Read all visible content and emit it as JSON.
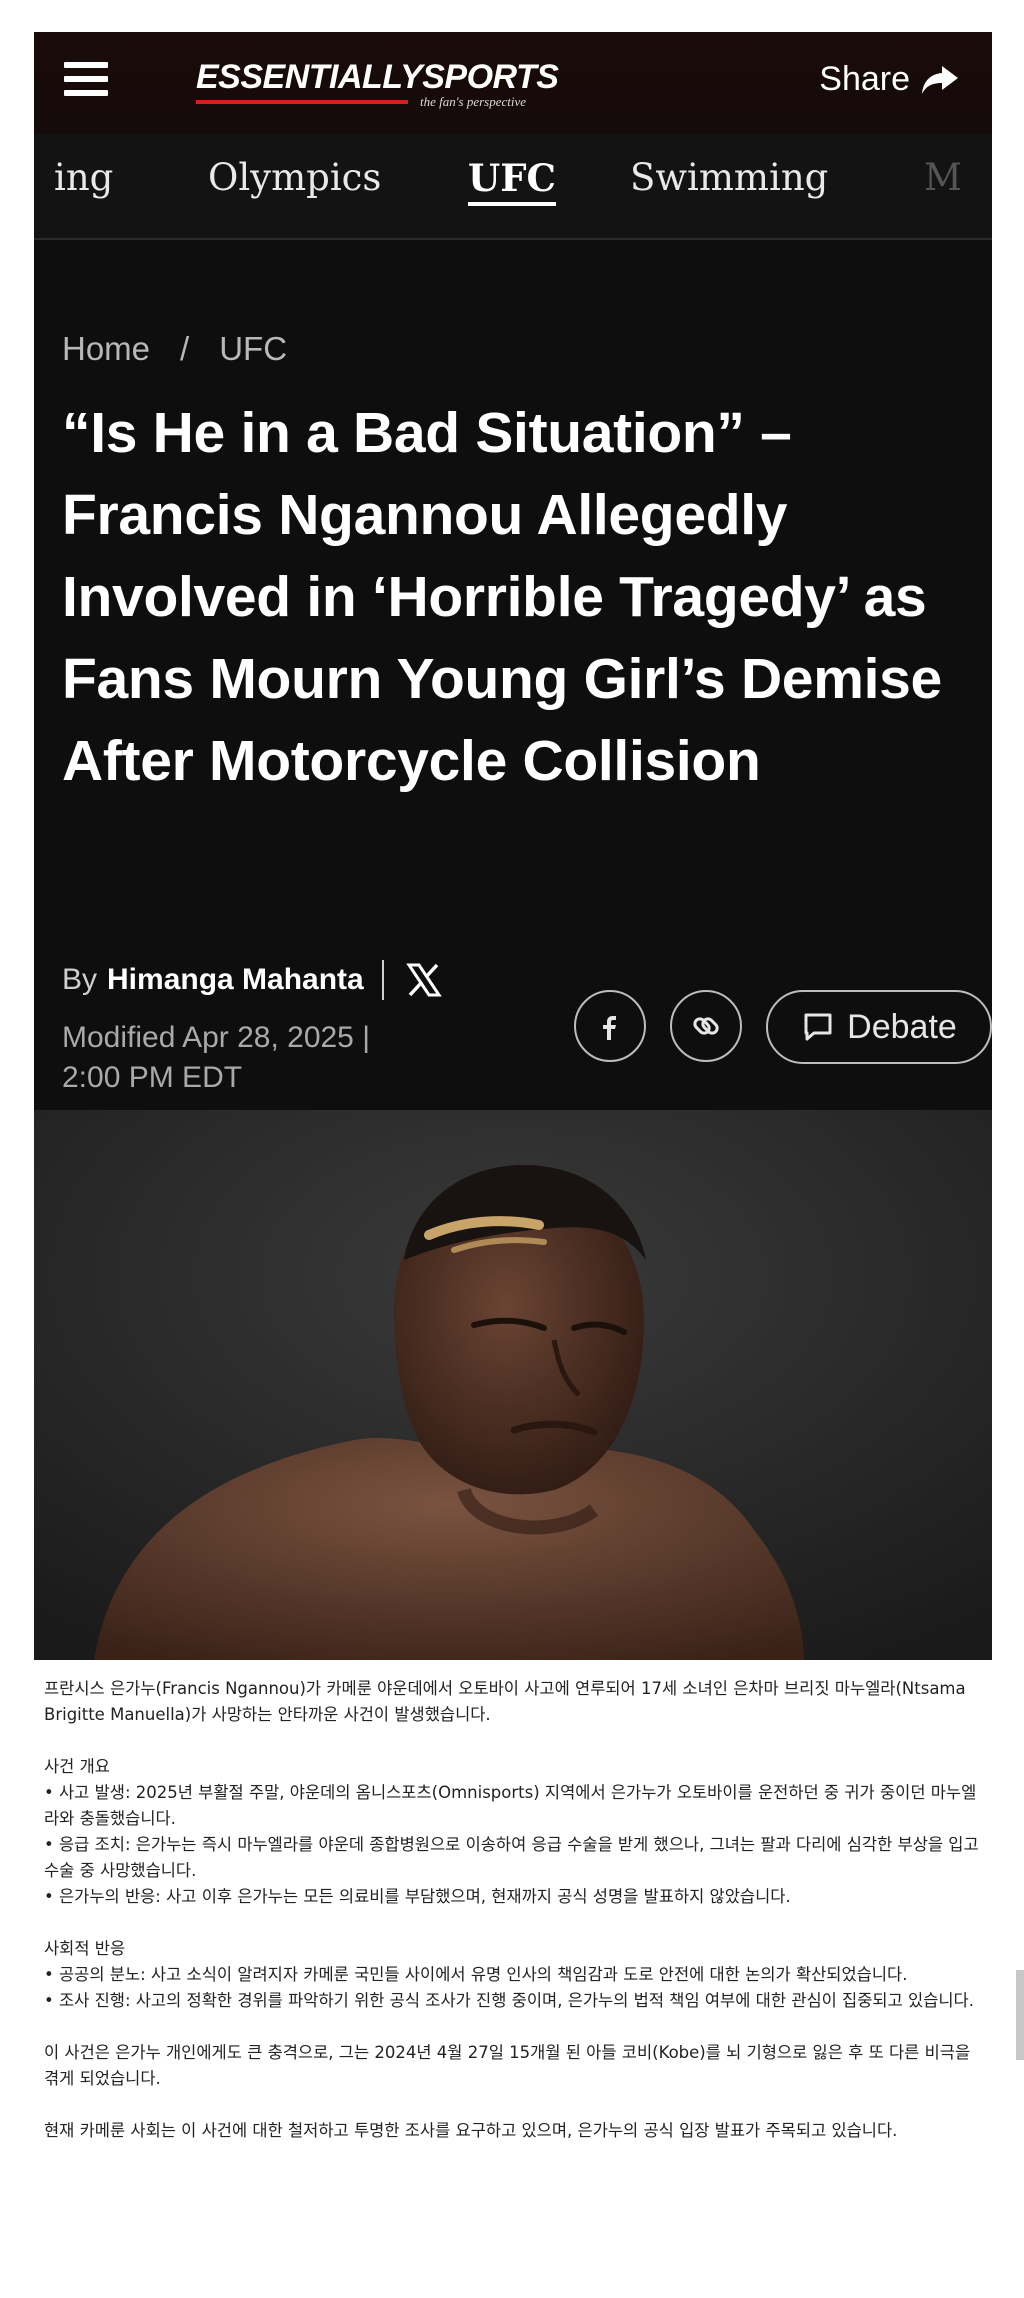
{
  "header": {
    "logo_text": "ESSENTIALLYSPORTS",
    "logo_tagline": "the fan's perspective",
    "share_label": "Share",
    "menu_icon": "hamburger-menu-icon",
    "share_icon": "share-arrow-icon"
  },
  "nav": {
    "items": [
      {
        "label": "ing",
        "state": "partial"
      },
      {
        "label": "Olympics",
        "state": "normal"
      },
      {
        "label": "UFC",
        "state": "active"
      },
      {
        "label": "Swimming",
        "state": "normal"
      },
      {
        "label": "M",
        "state": "partial"
      }
    ]
  },
  "breadcrumb": {
    "home": "Home",
    "separator": "/",
    "section": "UFC"
  },
  "article": {
    "headline": "“Is He in a Bad Situation” – Francis Ngannou Allegedly Involved in ‘Horrible Tragedy’ as Fans Mourn Young Girl’s Demise After Motorcycle Collision",
    "by_prefix": "By",
    "author": "Himanga Mahanta",
    "modified_line1": "Modified Apr 28, 2025 |",
    "modified_line2": "2:00 PM EDT",
    "debate_label": "Debate"
  },
  "colors": {
    "background": "#0f0e0e",
    "brand_red": "#d6201b",
    "text": "#ffffff"
  },
  "korean_text": {
    "intro": "프란시스 은가누(Francis Ngannou)가 카메룬 야운데에서 오토바이 사고에 연루되어 17세 소녀인 은차마 브리짓 마누엘라(Ntsama Brigitte Manuella)가 사망하는 안타까운 사건이 발생했습니다. ",
    "overview_title": "사건 개요",
    "overview_1": "• 사고 발생: 2025년 부활절 주말, 야운데의 옴니스포츠(Omnisports) 지역에서 은가누가 오토바이를 운전하던 중 귀가 중이던 마누엘라와 충돌했습니다. ",
    "overview_2": "• 응급 조치: 은가누는 즉시 마누엘라를 야운데 종합병원으로 이송하여 응급 수술을 받게 했으나, 그녀는 팔과 다리에 심각한 부상을 입고 수술 중 사망했습니다.",
    "overview_3": "• 은가누의 반응: 사고 이후 은가누는 모든 의료비를 부담했으며, 현재까지 공식 성명을 발표하지 않았습니다.",
    "reaction_title": "사회적 반응",
    "reaction_1": "• 공공의 분노: 사고 소식이 알려지자 카메룬 국민들 사이에서 유명 인사의 책임감과 도로 안전에 대한 논의가 확산되었습니다.",
    "reaction_2": "• 조사 진행: 사고의 정확한 경위를 파악하기 위한 공식 조사가 진행 중이며, 은가누의 법적 책임 여부에 대한 관심이 집중되고 있습니다. ",
    "para_1": "이 사건은 은가누 개인에게도 큰 충격으로, 그는 2024년 4월 27일 15개월 된 아들 코비(Kobe)를 뇌 기형으로 잃은 후 또 다른 비극을 겪게 되었습니다. ",
    "para_2": "현재 카메룬 사회는 이 사건에 대한 철저하고 투명한 조사를 요구하고 있으며, 은가누의 공식 입장 발표가 주목되고 있습니다."
  }
}
